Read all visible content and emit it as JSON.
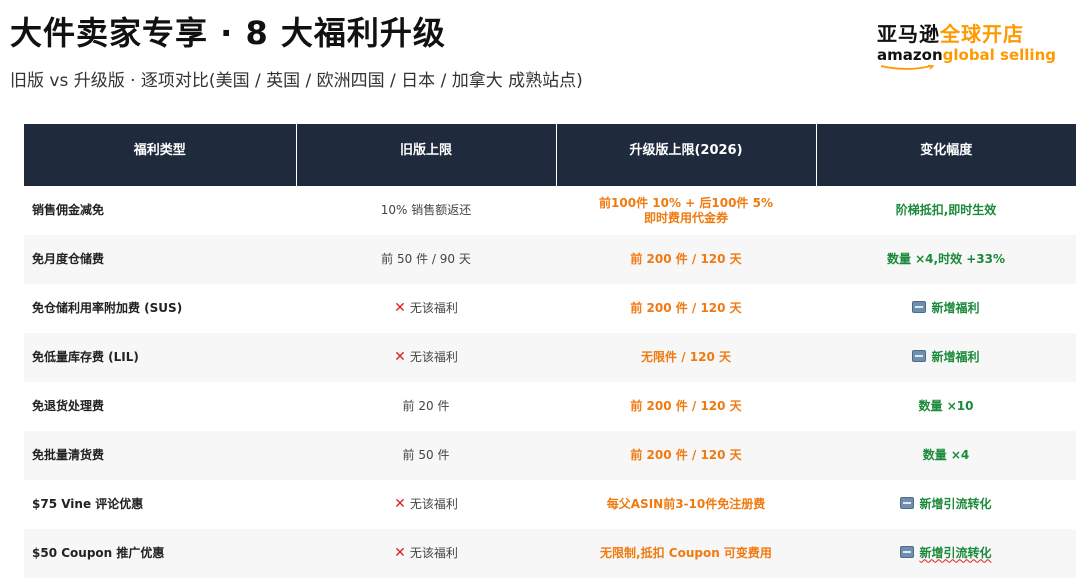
{
  "header": {
    "title": "大件卖家专享 · 8 大福利升级",
    "subtitle": "旧版 vs 升级版 · 逐项对比(美国 / 英国 / 欧洲四国 / 日本 / 加拿大 成熟站点)"
  },
  "logo": {
    "cn_dark": "亚马逊",
    "cn_orange": "全球开店",
    "en_amazon": "amazon",
    "en_global": "global selling"
  },
  "table": {
    "headers": [
      "福利类型",
      "旧版上限",
      "升级版上限(2026)",
      "变化幅度"
    ],
    "rows": [
      {
        "type": "销售佣金减免",
        "old": "10% 销售额返还",
        "old_none": false,
        "new_line1": "前100件 10% + 后100件 5%",
        "new_line2": "即时费用代金券",
        "change": "阶梯抵扣,即时生效",
        "change_new_badge": false
      },
      {
        "type": "免月度仓储费",
        "old": "前 50 件 / 90 天",
        "old_none": false,
        "new_line1": "前 200 件 / 120 天",
        "new_line2": "",
        "change": "数量 ×4,时效 +33%",
        "change_new_badge": false
      },
      {
        "type": "免仓储利用率附加费 (SUS)",
        "old": "无该福利",
        "old_none": true,
        "new_line1": "前 200 件 / 120 天",
        "new_line2": "",
        "change": "新增福利",
        "change_new_badge": true
      },
      {
        "type": "免低量库存费 (LIL)",
        "old": "无该福利",
        "old_none": true,
        "new_line1": "无限件 / 120 天",
        "new_line2": "",
        "change": "新增福利",
        "change_new_badge": true
      },
      {
        "type": "免退货处理费",
        "old": "前 20 件",
        "old_none": false,
        "new_line1": "前 200 件 / 120 天",
        "new_line2": "",
        "change": "数量 ×10",
        "change_new_badge": false
      },
      {
        "type": "免批量清货费",
        "old": "前 50 件",
        "old_none": false,
        "new_line1": "前 200 件 / 120 天",
        "new_line2": "",
        "change": "数量 ×4",
        "change_new_badge": false
      },
      {
        "type": "$75 Vine 评论优惠",
        "old": "无该福利",
        "old_none": true,
        "new_line1": "每父ASIN前3-10件免注册费",
        "new_line2": "",
        "change": "新增引流转化",
        "change_new_badge": true
      },
      {
        "type": "$50 Coupon 推广优惠",
        "old": "无该福利",
        "old_none": true,
        "new_line1": "无限制,抵扣 Coupon 可变费用",
        "new_line2": "",
        "change": "新增引流转化",
        "change_new_badge": true
      }
    ]
  },
  "colors": {
    "header_bg": "#1f2b3d",
    "accent_orange": "#f07a10",
    "accent_green": "#1a8a3a",
    "cross_red": "#e02020"
  },
  "icons": {
    "none_icon": "cross-mark-icon",
    "new_icon": "new-badge-icon"
  }
}
